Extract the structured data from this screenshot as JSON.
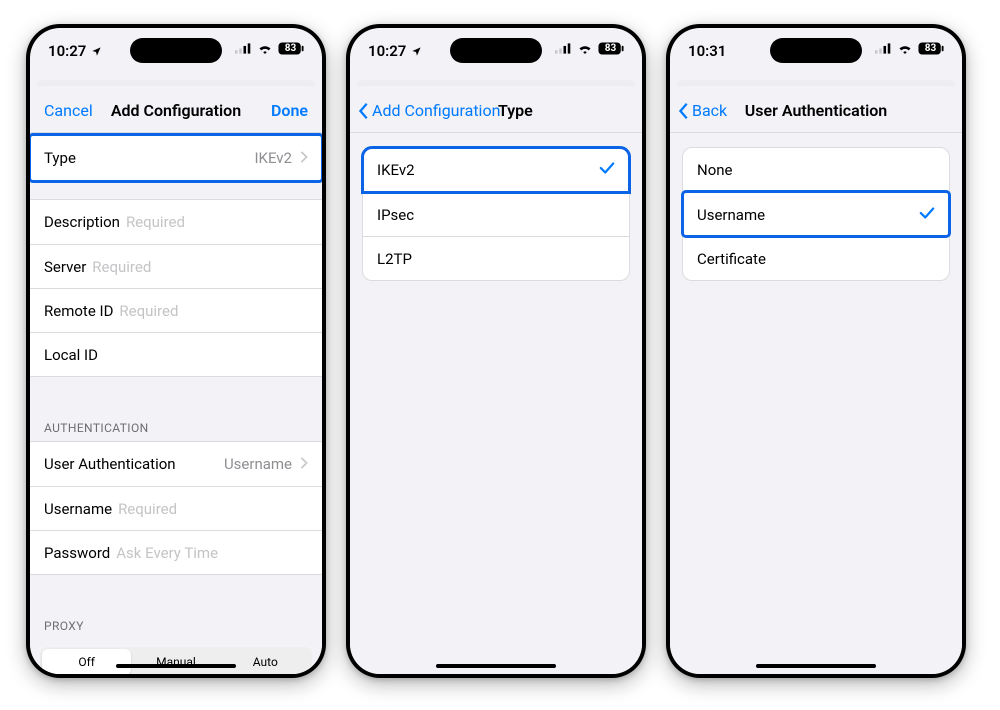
{
  "status": {
    "time_a": "10:27",
    "time_b": "10:27",
    "time_c": "10:31",
    "battery": "83"
  },
  "screen1": {
    "nav_left": "Cancel",
    "nav_title": "Add Configuration",
    "nav_right": "Done",
    "type_label": "Type",
    "type_value": "IKEv2",
    "fields": {
      "description": "Description",
      "server": "Server",
      "remote_id": "Remote ID",
      "local_id": "Local ID",
      "required": "Required"
    },
    "auth_header": "AUTHENTICATION",
    "user_auth_label": "User Authentication",
    "user_auth_value": "Username",
    "username_label": "Username",
    "password_label": "Password",
    "password_placeholder": "Ask Every Time",
    "proxy_header": "PROXY",
    "seg": {
      "off": "Off",
      "manual": "Manual",
      "auto": "Auto"
    }
  },
  "screen2": {
    "back_label": "Add Configuration",
    "title": "Type",
    "options": [
      "IKEv2",
      "IPsec",
      "L2TP"
    ],
    "selected_index": 0
  },
  "screen3": {
    "back_label": "Back",
    "title": "User Authentication",
    "options": [
      "None",
      "Username",
      "Certificate"
    ],
    "selected_index": 1
  }
}
